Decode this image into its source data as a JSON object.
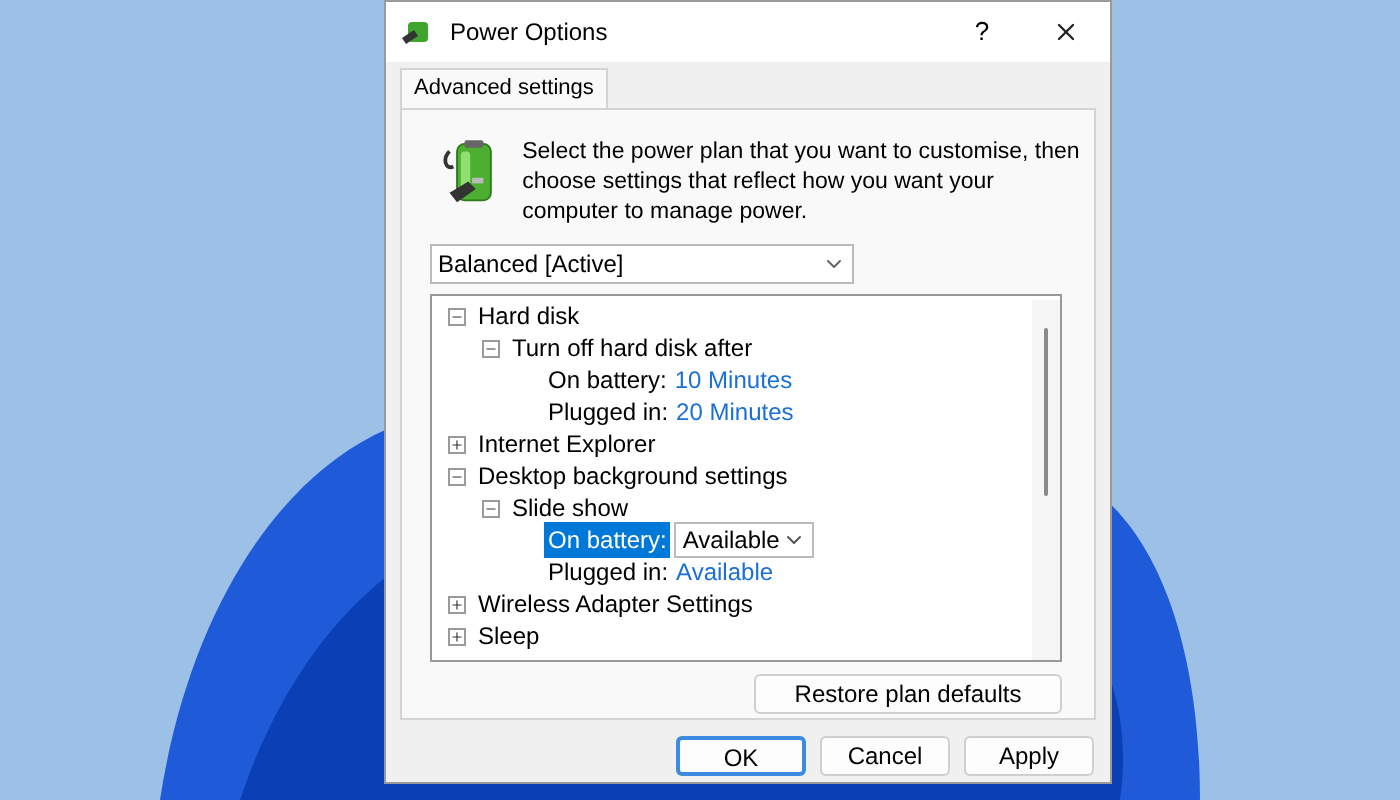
{
  "window": {
    "title": "Power Options",
    "help": "?"
  },
  "tabs": [
    {
      "label": "Advanced settings",
      "selected": true
    }
  ],
  "description": "Select the power plan that you want to customise, then choose settings that reflect how you want your computer to manage power.",
  "plan_dropdown": {
    "value": "Balanced [Active]"
  },
  "tree": [
    {
      "kind": "group",
      "label": "Hard disk",
      "expanded": true,
      "children": [
        {
          "kind": "group",
          "label": "Turn off hard disk after",
          "expanded": true,
          "children": [
            {
              "kind": "setting",
              "label": "On battery:",
              "value": "10 Minutes",
              "selected": false
            },
            {
              "kind": "setting",
              "label": "Plugged in:",
              "value": "20 Minutes",
              "selected": false
            }
          ]
        }
      ]
    },
    {
      "kind": "group",
      "label": "Internet Explorer",
      "expanded": false
    },
    {
      "kind": "group",
      "label": "Desktop background settings",
      "expanded": true,
      "children": [
        {
          "kind": "group",
          "label": "Slide show",
          "expanded": true,
          "children": [
            {
              "kind": "setting",
              "label": "On battery:",
              "value": "Available",
              "selected": true
            },
            {
              "kind": "setting",
              "label": "Plugged in:",
              "value": "Available",
              "selected": false
            }
          ]
        }
      ]
    },
    {
      "kind": "group",
      "label": "Wireless Adapter Settings",
      "expanded": false
    },
    {
      "kind": "group",
      "label": "Sleep",
      "expanded": false
    }
  ],
  "restore_button": "Restore plan defaults",
  "dialog_buttons": [
    {
      "label": "OK",
      "default": true
    },
    {
      "label": "Cancel",
      "default": false
    },
    {
      "label": "Apply",
      "default": false
    }
  ]
}
